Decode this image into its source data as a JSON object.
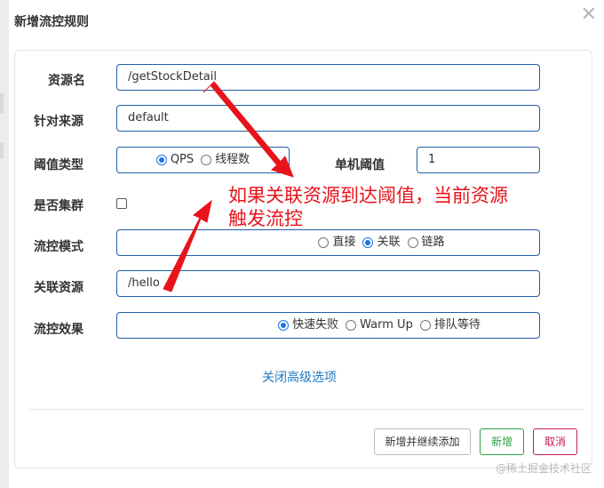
{
  "dialog": {
    "title": "新增流控规则",
    "close_icon": "close-icon"
  },
  "form": {
    "resource_name": {
      "label": "资源名",
      "value": "/getStockDetail"
    },
    "limit_app": {
      "label": "针对来源",
      "value": "default"
    },
    "threshold_type": {
      "label": "阈值类型",
      "options": [
        {
          "label": "QPS",
          "selected": true
        },
        {
          "label": "线程数",
          "selected": false
        }
      ]
    },
    "single_threshold": {
      "label": "单机阈值",
      "value": "1"
    },
    "cluster": {
      "label": "是否集群",
      "checked": false
    },
    "flow_mode": {
      "label": "流控模式",
      "options": [
        {
          "label": "直接",
          "selected": false
        },
        {
          "label": "关联",
          "selected": true
        },
        {
          "label": "链路",
          "selected": false
        }
      ]
    },
    "ref_resource": {
      "label": "关联资源",
      "value": "/hello"
    },
    "control_behavior": {
      "label": "流控效果",
      "options": [
        {
          "label": "快速失败",
          "selected": true
        },
        {
          "label": "Warm Up",
          "selected": false
        },
        {
          "label": "排队等待",
          "selected": false
        }
      ]
    },
    "advanced_toggle": "关闭高级选项"
  },
  "footer": {
    "save_continue": "新增并继续添加",
    "add": "新增",
    "cancel": "取消"
  },
  "annotation": {
    "line1": "如果关联资源到达阈值，当前资源",
    "line2": "触发流控",
    "color": "#e8131b"
  },
  "watermark": "@稀土掘金技术社区",
  "colors": {
    "input_border": "#1f5ea8",
    "radio_accent": "#1a73e8",
    "link": "#1f7ac1",
    "add_button": "#2e9e45",
    "cancel_button": "#c2185b"
  }
}
